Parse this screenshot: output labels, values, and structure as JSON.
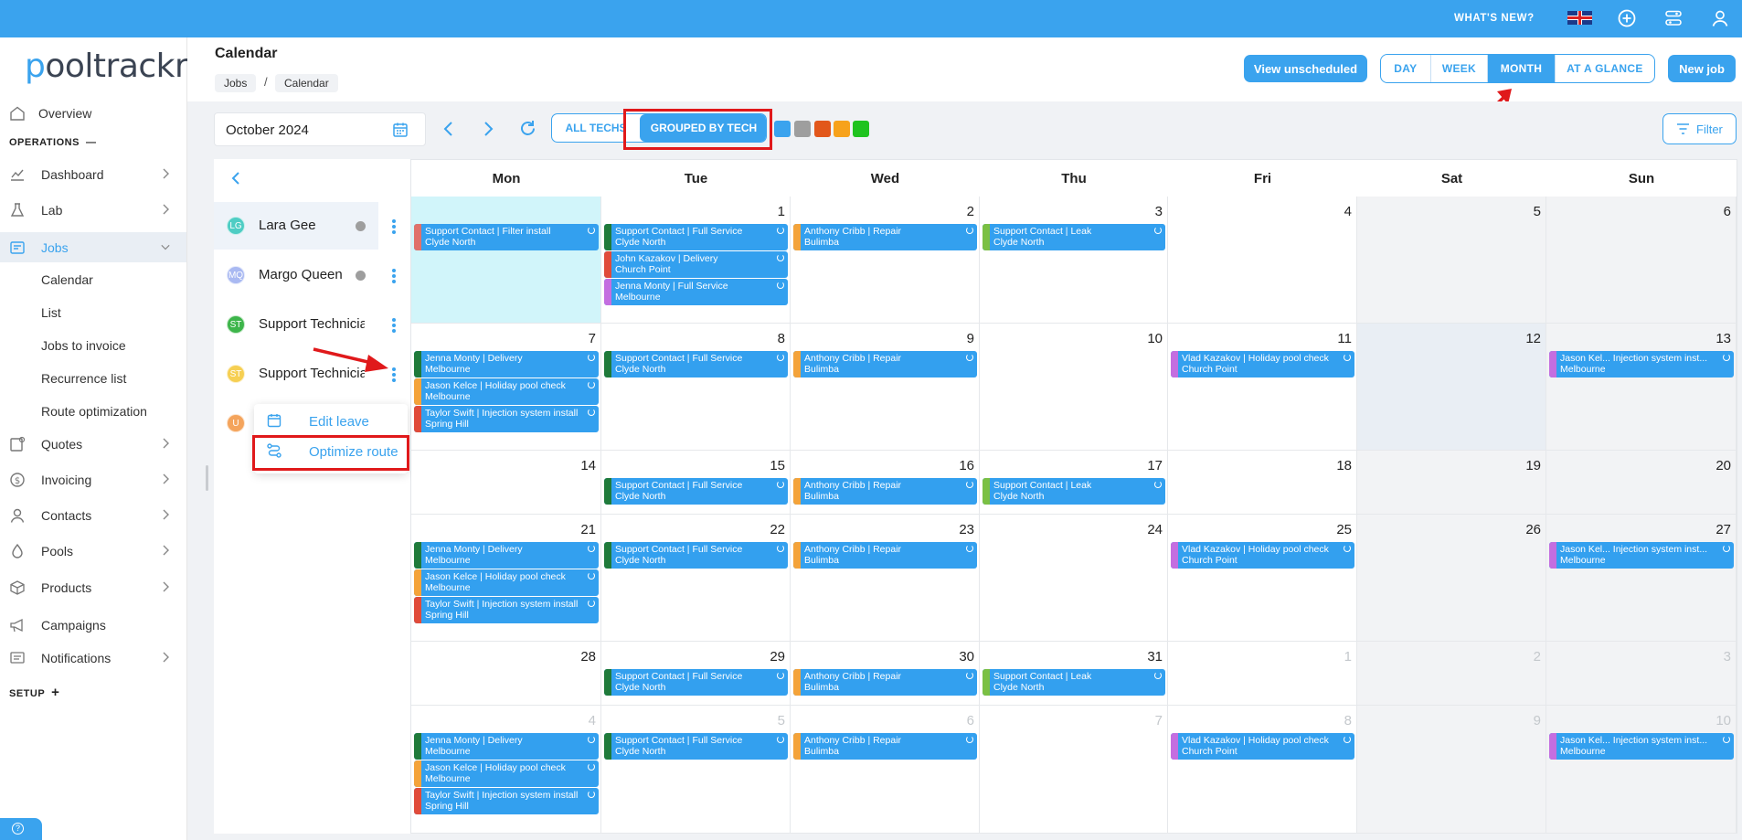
{
  "topbar": {
    "whats_new": "WHAT'S NEW?"
  },
  "app": {
    "logo": "pooltrackr"
  },
  "sidebar": {
    "overview": "Overview",
    "operations_label": "OPERATIONS",
    "operations_toggle": "—",
    "items": [
      {
        "label": "Dashboard"
      },
      {
        "label": "Lab"
      },
      {
        "label": "Jobs"
      },
      {
        "label": "Quotes"
      },
      {
        "label": "Invoicing"
      },
      {
        "label": "Contacts"
      },
      {
        "label": "Pools"
      },
      {
        "label": "Products"
      },
      {
        "label": "Campaigns"
      },
      {
        "label": "Notifications"
      }
    ],
    "jobs_sub": [
      "Calendar",
      "List",
      "Jobs to invoice",
      "Recurrence list",
      "Route optimization"
    ],
    "setup_label": "SETUP",
    "setup_toggle": "+"
  },
  "header": {
    "title": "Calendar",
    "breadcrumb": [
      "Jobs",
      "Calendar"
    ],
    "view_unscheduled": "View unscheduled",
    "views": [
      "DAY",
      "WEEK",
      "MONTH",
      "AT A GLANCE"
    ],
    "selected_view": "MONTH",
    "new_job": "New job"
  },
  "toolbar": {
    "month": "October 2024",
    "all_techs": "ALL TECHS",
    "grouped_by_tech": "GROUPED BY TECH",
    "filter": "Filter",
    "swatch_colors": [
      "#3aa3ee",
      "#9e9e9e",
      "#e2571b",
      "#f7a21b",
      "#1fc31f"
    ]
  },
  "techs": [
    {
      "initials": "LG",
      "name": "Lara Gee",
      "color": "#4ecdc4"
    },
    {
      "initials": "MQ",
      "name": "Margo Queen",
      "color": "#a9b9f2"
    },
    {
      "initials": "ST",
      "name": "Support Technician",
      "color": "#3db54a"
    },
    {
      "initials": "ST",
      "name": "Support Technician",
      "color": "#f6cf52"
    },
    {
      "initials": "U",
      "name": "",
      "color": "#f4a45c"
    }
  ],
  "context_menu": {
    "edit_leave": "Edit leave",
    "optimize_route": "Optimize route"
  },
  "calendar": {
    "days": [
      "Mon",
      "Tue",
      "Wed",
      "Thu",
      "Fri",
      "Sat",
      "Sun"
    ],
    "weeks": [
      [
        "",
        "1",
        "2",
        "3",
        "4",
        "5",
        "6"
      ],
      [
        "7",
        "8",
        "9",
        "10",
        "11",
        "12",
        "13"
      ],
      [
        "14",
        "15",
        "16",
        "17",
        "18",
        "19",
        "20"
      ],
      [
        "21",
        "22",
        "23",
        "24",
        "25",
        "26",
        "27"
      ],
      [
        "28",
        "29",
        "30",
        "31",
        "1",
        "2",
        "3"
      ],
      [
        "4",
        "5",
        "6",
        "7",
        "8",
        "9",
        "10"
      ]
    ],
    "events": {
      "sc_filter": [
        "Support Contact | Filter install",
        "Clyde North"
      ],
      "sc_full": [
        "Support Contact | Full Service",
        "Clyde North"
      ],
      "jk_delivery": [
        "John Kazakov | Delivery",
        "Church Point"
      ],
      "jm_full": [
        "Jenna Monty | Full Service",
        "Melbourne"
      ],
      "ac_repair": [
        "Anthony Cribb | Repair",
        "Bulimba"
      ],
      "sc_leak": [
        "Support Contact | Leak",
        "Clyde North"
      ],
      "jm_delivery": [
        "Jenna Monty | Delivery",
        "Melbourne"
      ],
      "jk_holiday": [
        "Jason Kelce | Holiday pool check",
        "Melbourne"
      ],
      "ts_injection": [
        "Taylor Swift | Injection system install",
        "Spring Hill"
      ],
      "vk_holiday": [
        "Vlad Kazakov | Holiday pool check",
        "Church Point"
      ],
      "jk_injection": [
        "Jason Kel...  Injection system inst...",
        "Melbourne"
      ]
    }
  }
}
